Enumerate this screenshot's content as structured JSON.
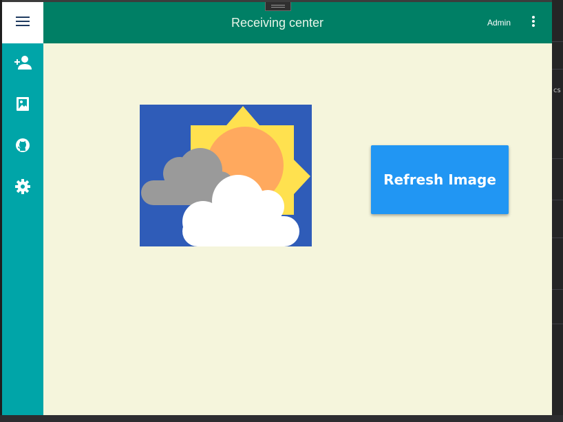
{
  "app": {
    "title": "Receiving center",
    "user_label": "Admin"
  },
  "header": {
    "menu_icon": "hamburger-menu-icon",
    "more_icon": "more-vert-icon"
  },
  "sidebar": {
    "items": [
      {
        "icon": "add-person-icon"
      },
      {
        "icon": "image-icon"
      },
      {
        "icon": "github-icon"
      },
      {
        "icon": "gear-icon"
      }
    ]
  },
  "main": {
    "image_icon": "partly-cloudy-weather-image",
    "refresh_label": "Refresh Image"
  },
  "background": {
    "right_edge_text": "cs"
  },
  "colors": {
    "topbar": "#007f65",
    "sidebar": "#00a5a8",
    "content_bg": "#f5f5dc",
    "button": "#2196f3",
    "image_bg": "#2f5cb8"
  }
}
